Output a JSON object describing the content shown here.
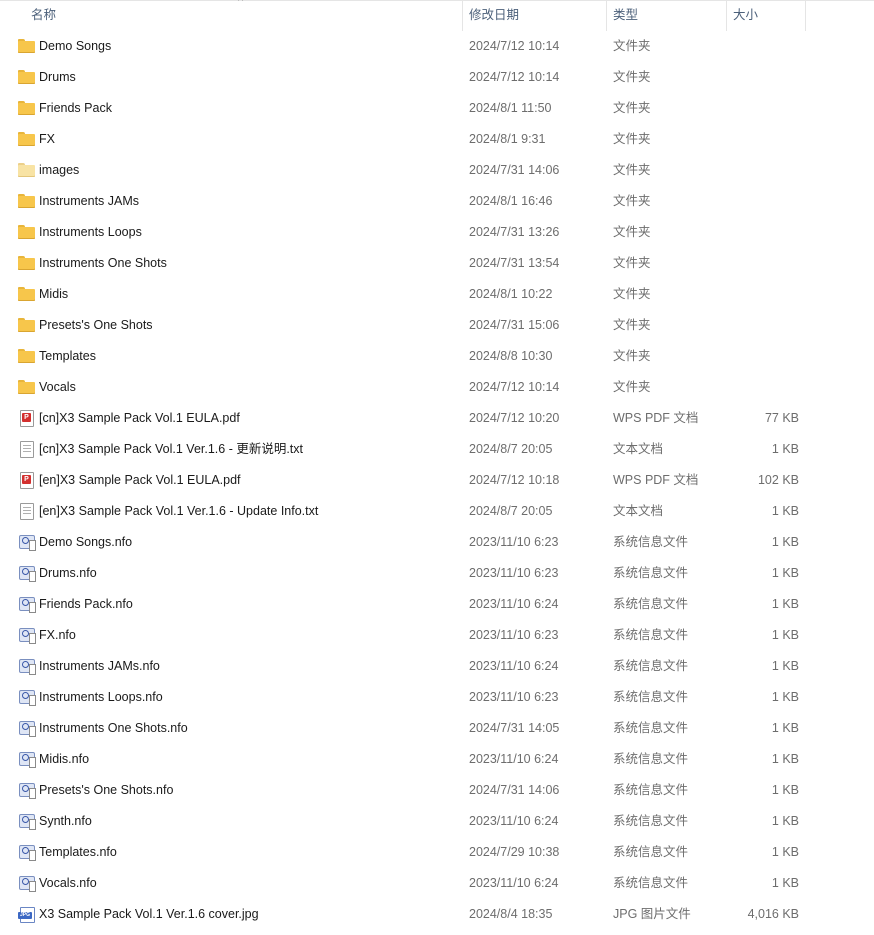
{
  "columns": {
    "name": "名称",
    "date": "修改日期",
    "type": "类型",
    "size": "大小",
    "sort_indicator": "^"
  },
  "files": [
    {
      "name": "Demo Songs",
      "date": "2024/7/12 10:14",
      "type": "文件夹",
      "size": "",
      "icon": "folder-icon"
    },
    {
      "name": "Drums",
      "date": "2024/7/12 10:14",
      "type": "文件夹",
      "size": "",
      "icon": "folder-icon"
    },
    {
      "name": "Friends Pack",
      "date": "2024/8/1 11:50",
      "type": "文件夹",
      "size": "",
      "icon": "folder-icon"
    },
    {
      "name": "FX",
      "date": "2024/8/1 9:31",
      "type": "文件夹",
      "size": "",
      "icon": "folder-icon"
    },
    {
      "name": "images",
      "date": "2024/7/31 14:06",
      "type": "文件夹",
      "size": "",
      "icon": "folder-empty-icon"
    },
    {
      "name": "Instruments JAMs",
      "date": "2024/8/1 16:46",
      "type": "文件夹",
      "size": "",
      "icon": "folder-icon"
    },
    {
      "name": "Instruments Loops",
      "date": "2024/7/31 13:26",
      "type": "文件夹",
      "size": "",
      "icon": "folder-icon"
    },
    {
      "name": "Instruments One Shots",
      "date": "2024/7/31 13:54",
      "type": "文件夹",
      "size": "",
      "icon": "folder-icon"
    },
    {
      "name": "Midis",
      "date": "2024/8/1 10:22",
      "type": "文件夹",
      "size": "",
      "icon": "folder-icon"
    },
    {
      "name": "Presets's One Shots",
      "date": "2024/7/31 15:06",
      "type": "文件夹",
      "size": "",
      "icon": "folder-icon"
    },
    {
      "name": "Templates",
      "date": "2024/8/8 10:30",
      "type": "文件夹",
      "size": "",
      "icon": "folder-icon"
    },
    {
      "name": "Vocals",
      "date": "2024/7/12 10:14",
      "type": "文件夹",
      "size": "",
      "icon": "folder-icon"
    },
    {
      "name": "[cn]X3 Sample Pack Vol.1 EULA.pdf",
      "date": "2024/7/12 10:20",
      "type": "WPS PDF 文档",
      "size": "77 KB",
      "icon": "pdf-icon"
    },
    {
      "name": "[cn]X3 Sample Pack Vol.1 Ver.1.6 - 更新说明.txt",
      "date": "2024/8/7 20:05",
      "type": "文本文档",
      "size": "1 KB",
      "icon": "text-file-icon"
    },
    {
      "name": "[en]X3 Sample Pack Vol.1 EULA.pdf",
      "date": "2024/7/12 10:18",
      "type": "WPS PDF 文档",
      "size": "102 KB",
      "icon": "pdf-icon"
    },
    {
      "name": "[en]X3 Sample Pack Vol.1 Ver.1.6 - Update Info.txt",
      "date": "2024/8/7 20:05",
      "type": "文本文档",
      "size": "1 KB",
      "icon": "text-file-icon"
    },
    {
      "name": "Demo Songs.nfo",
      "date": "2023/11/10 6:23",
      "type": "系统信息文件",
      "size": "1 KB",
      "icon": "system-info-icon"
    },
    {
      "name": "Drums.nfo",
      "date": "2023/11/10 6:23",
      "type": "系统信息文件",
      "size": "1 KB",
      "icon": "system-info-icon"
    },
    {
      "name": "Friends Pack.nfo",
      "date": "2023/11/10 6:24",
      "type": "系统信息文件",
      "size": "1 KB",
      "icon": "system-info-icon"
    },
    {
      "name": "FX.nfo",
      "date": "2023/11/10 6:23",
      "type": "系统信息文件",
      "size": "1 KB",
      "icon": "system-info-icon"
    },
    {
      "name": "Instruments JAMs.nfo",
      "date": "2023/11/10 6:24",
      "type": "系统信息文件",
      "size": "1 KB",
      "icon": "system-info-icon"
    },
    {
      "name": "Instruments Loops.nfo",
      "date": "2023/11/10 6:23",
      "type": "系统信息文件",
      "size": "1 KB",
      "icon": "system-info-icon"
    },
    {
      "name": "Instruments One Shots.nfo",
      "date": "2024/7/31 14:05",
      "type": "系统信息文件",
      "size": "1 KB",
      "icon": "system-info-icon"
    },
    {
      "name": "Midis.nfo",
      "date": "2023/11/10 6:24",
      "type": "系统信息文件",
      "size": "1 KB",
      "icon": "system-info-icon"
    },
    {
      "name": "Presets's One Shots.nfo",
      "date": "2024/7/31 14:06",
      "type": "系统信息文件",
      "size": "1 KB",
      "icon": "system-info-icon"
    },
    {
      "name": "Synth.nfo",
      "date": "2023/11/10 6:24",
      "type": "系统信息文件",
      "size": "1 KB",
      "icon": "system-info-icon"
    },
    {
      "name": "Templates.nfo",
      "date": "2024/7/29 10:38",
      "type": "系统信息文件",
      "size": "1 KB",
      "icon": "system-info-icon"
    },
    {
      "name": "Vocals.nfo",
      "date": "2023/11/10 6:24",
      "type": "系统信息文件",
      "size": "1 KB",
      "icon": "system-info-icon"
    },
    {
      "name": "X3 Sample Pack Vol.1 Ver.1.6 cover.jpg",
      "date": "2024/8/4 18:35",
      "type": "JPG 图片文件",
      "size": "4,016 KB",
      "icon": "jpg-image-icon"
    }
  ]
}
